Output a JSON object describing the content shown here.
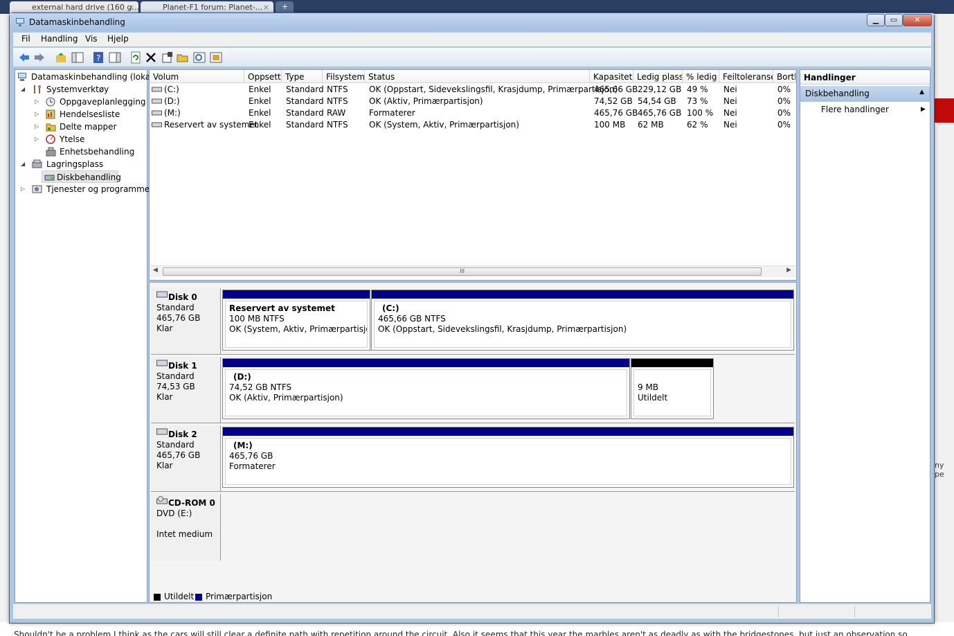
{
  "browser": {
    "tabs": [
      {
        "label": "external hard drive (160 g..."
      },
      {
        "label": "Planet-F1 forum: Planet-..."
      }
    ],
    "new_tab": "+",
    "close": "×",
    "page_text": "Shouldn't be a problem I think as the cars will still clear a definite path with repetition around the circuit. Also it seems that this year the marbles aren't as deadly as with the bridgestones, but just an observation so",
    "right_snippet": "ny pe"
  },
  "window": {
    "title": "Datamaskinbehandling",
    "min_label": "▁",
    "max_label": "▭",
    "close_label": "✕"
  },
  "menu": {
    "items": [
      "Fil",
      "Handling",
      "Vis",
      "Hjelp"
    ]
  },
  "toolbar": {
    "icons": [
      "back-icon",
      "forward-icon",
      "up-folder-icon",
      "console-tree-icon",
      "help-icon",
      "action-pane-icon",
      "refresh-icon",
      "delete-icon",
      "properties-icon",
      "open-icon",
      "search-icon",
      "wizard-icon"
    ]
  },
  "tree": {
    "root": "Datamaskinbehandling (lokal)",
    "items": [
      {
        "label": "Systemverktøy"
      },
      {
        "label": "Oppgaveplanlegging"
      },
      {
        "label": "Hendelsesliste"
      },
      {
        "label": "Delte mapper"
      },
      {
        "label": "Ytelse"
      },
      {
        "label": "Enhetsbehandling"
      },
      {
        "label": "Lagringsplass"
      },
      {
        "label": "Diskbehandling"
      },
      {
        "label": "Tjenester og programmer"
      }
    ]
  },
  "volumes": {
    "columns": [
      "Volum",
      "Oppsett",
      "Type",
      "Filsystem",
      "Status",
      "Kapasitet",
      "Ledig plass",
      "% ledig",
      "Feiltoleranse",
      "Bortk"
    ],
    "rows": [
      [
        "(C:)",
        "Enkel",
        "Standard",
        "NTFS",
        "OK (Oppstart, Sidevekslingsfil, Krasjdump, Primærpartisjon)",
        "465,66 GB",
        "229,12 GB",
        "49 %",
        "Nei",
        "0%"
      ],
      [
        "(D:)",
        "Enkel",
        "Standard",
        "NTFS",
        "OK (Aktiv, Primærpartisjon)",
        "74,52 GB",
        "54,54 GB",
        "73 %",
        "Nei",
        "0%"
      ],
      [
        "(M:)",
        "Enkel",
        "Standard",
        "RAW",
        "Formaterer",
        "465,76 GB",
        "465,76 GB",
        "100 %",
        "Nei",
        "0%"
      ],
      [
        "Reservert av systemet",
        "Enkel",
        "Standard",
        "NTFS",
        "OK (System, Aktiv, Primærpartisjon)",
        "100 MB",
        "62 MB",
        "62 %",
        "Nei",
        "0%"
      ]
    ],
    "scroll_grip": "III"
  },
  "disks": [
    {
      "name": "Disk 0",
      "type": "Standard",
      "size": "465,76 GB",
      "state": "Klar",
      "parts": [
        {
          "title": "Reservert av systemet",
          "line1": "100 MB NTFS",
          "line2": "OK (System, Aktiv, Primærpartisjon)"
        },
        {
          "title": "(C:)",
          "line1": "465,66 GB NTFS",
          "line2": "OK (Oppstart, Sidevekslingsfil, Krasjdump, Primærpartisjon)"
        }
      ]
    },
    {
      "name": "Disk 1",
      "type": "Standard",
      "size": "74,53 GB",
      "state": "Klar",
      "parts": [
        {
          "title": "(D:)",
          "line1": "74,52 GB NTFS",
          "line2": "OK (Aktiv, Primærpartisjon)"
        },
        {
          "title": "",
          "line1": "9 MB",
          "line2": "Utildelt"
        }
      ]
    },
    {
      "name": "Disk 2",
      "type": "Standard",
      "size": "465,76 GB",
      "state": "Klar",
      "parts": [
        {
          "title": "(M:)",
          "line1": "465,76 GB",
          "line2": "Formaterer"
        }
      ]
    },
    {
      "name": "CD-ROM 0",
      "type": "DVD (E:)",
      "size": "",
      "state": "Intet medium"
    }
  ],
  "legend": {
    "unallocated": "Utildelt",
    "primary": "Primærpartisjon"
  },
  "actions": {
    "header": "Handlinger",
    "section": "Diskbehandling",
    "item": "Flere handlinger"
  },
  "colors": {
    "primary": "#00008b",
    "unallocated": "#000000",
    "selection": "#c6d8ee"
  }
}
